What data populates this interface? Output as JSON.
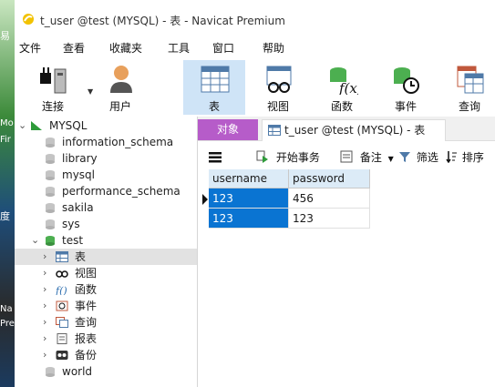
{
  "window": {
    "title": "t_user @test (MYSQL) - 表 - Navicat Premium"
  },
  "desktop": {
    "frags": [
      "易",
      "Mo",
      "Fir",
      "度",
      "Na",
      "Pre"
    ]
  },
  "menu": [
    "文件",
    "查看",
    "收藏夹",
    "工具",
    "窗口",
    "帮助"
  ],
  "toolbar": {
    "connect": "连接",
    "user": "用户",
    "table": "表",
    "view": "视图",
    "function": "函数",
    "event": "事件",
    "query": "查询"
  },
  "navigator": {
    "connection": "MYSQL",
    "databases": [
      "information_schema",
      "library",
      "mysql",
      "performance_schema",
      "sakila",
      "sys",
      "test",
      "world"
    ],
    "test_children": [
      "表",
      "视图",
      "函数",
      "事件",
      "查询",
      "报表",
      "备份"
    ]
  },
  "tabs": {
    "objects": "对象",
    "doc": "t_user @test (MYSQL) - 表"
  },
  "subtoolbar": {
    "begin_tx": "开始事务",
    "memo": "备注",
    "filter": "筛选",
    "sort": "排序"
  },
  "grid": {
    "columns": [
      "username",
      "password"
    ],
    "rows": [
      [
        "123",
        "456"
      ],
      [
        "123",
        "123"
      ]
    ]
  },
  "colors": {
    "objects_tab": "#b65cc9",
    "highlight": "#0a74d2",
    "header_bg": "#dcebf7",
    "active_tool": "#cfe4f7"
  }
}
